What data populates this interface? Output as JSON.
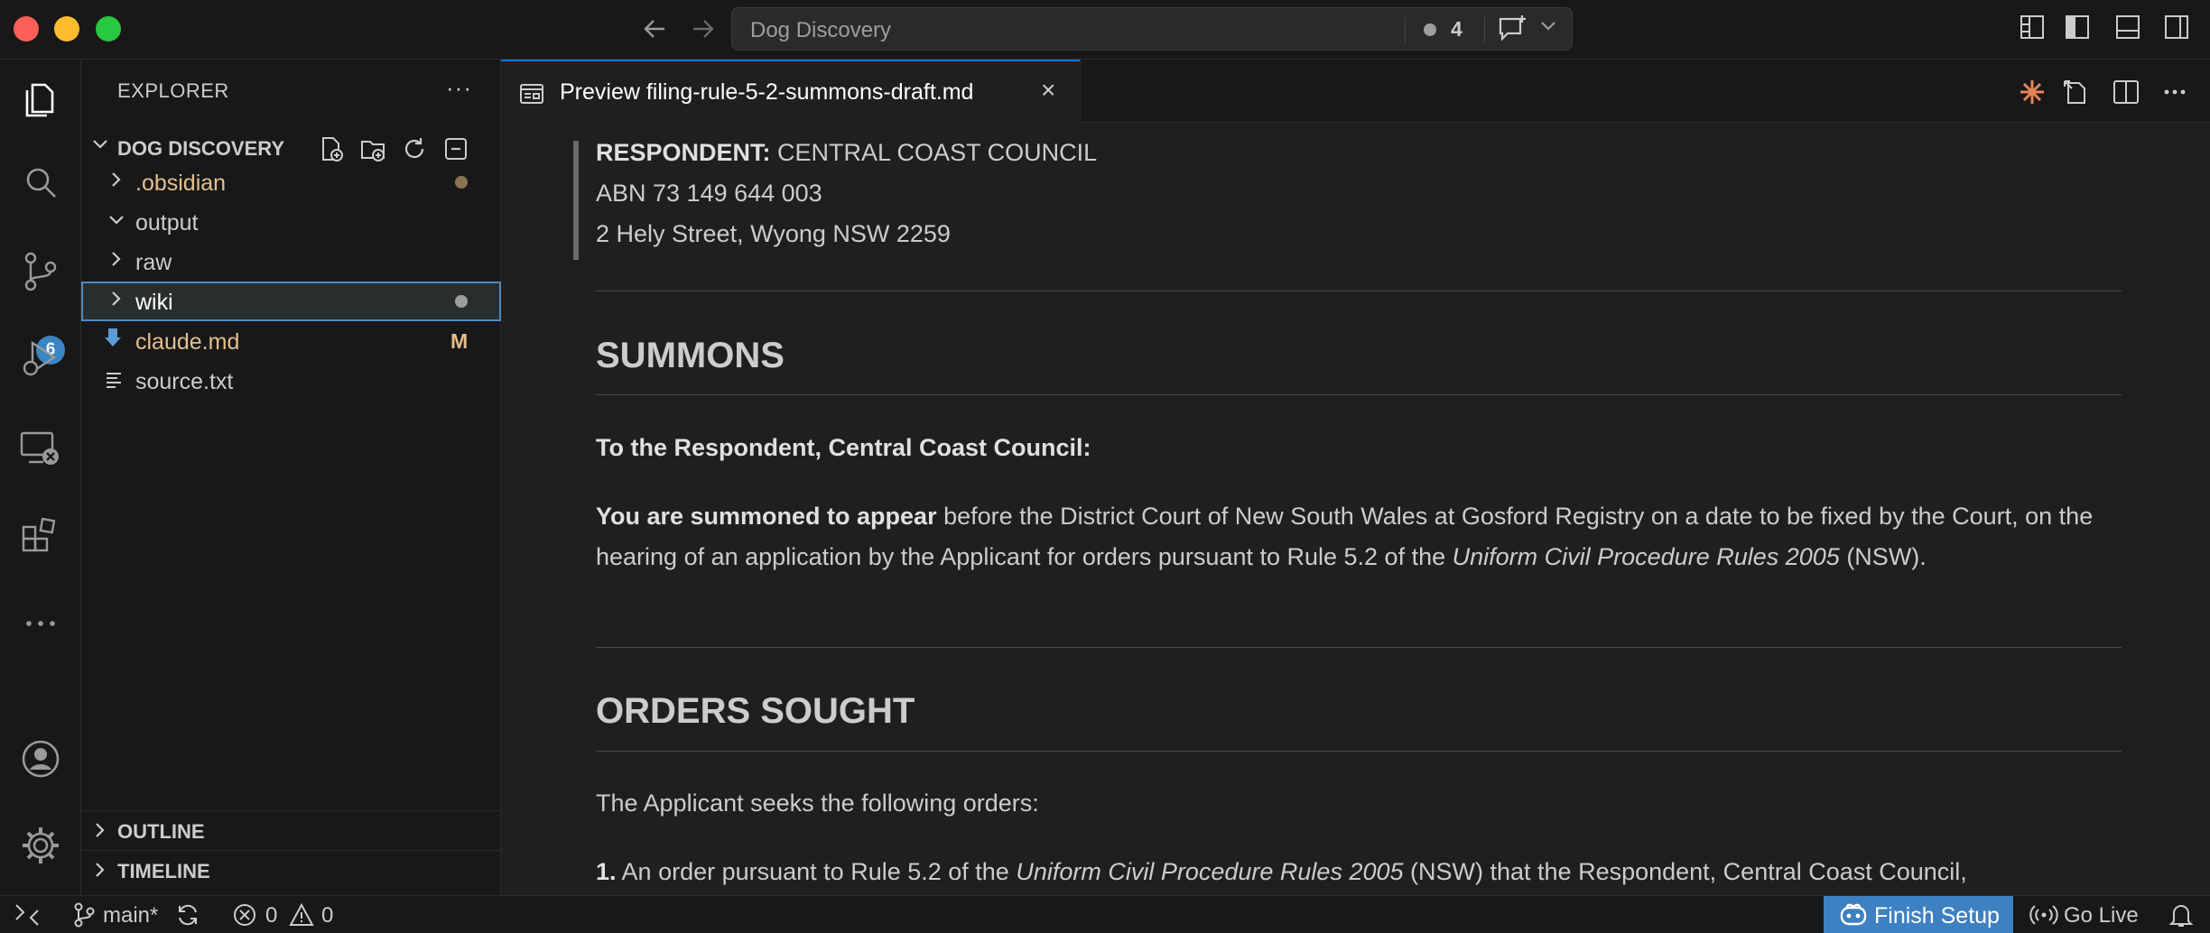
{
  "window": {
    "search_text": "Dog Discovery",
    "problem_count": "4"
  },
  "activity": {
    "scm_badge": "6"
  },
  "sidebar": {
    "title": "EXPLORER",
    "more": "···",
    "folder": "DOG DISCOVERY",
    "items": [
      {
        "name": ".obsidian",
        "color": "#e2c08d"
      },
      {
        "name": "output",
        "color": "#cccccc"
      },
      {
        "name": "raw",
        "color": "#cccccc"
      },
      {
        "name": "wiki",
        "color": "#cccccc"
      },
      {
        "name": "claude.md",
        "color": "#e2c08d",
        "status": "M"
      },
      {
        "name": "source.txt",
        "color": "#cccccc"
      }
    ],
    "outline": "OUTLINE",
    "timeline": "TIMELINE"
  },
  "tab": {
    "label": "Preview filing-rule-5-2-summons-draft.md",
    "close": "×"
  },
  "doc": {
    "respondent_label": "RESPONDENT:",
    "respondent_name": " CENTRAL COAST COUNCIL",
    "abn": "ABN 73 149 644 003",
    "address": "2 Hely Street, Wyong NSW 2259",
    "h_summons": "SUMMONS",
    "to_respondent": "To the Respondent, Central Coast Council:",
    "summoned_bold": "You are summoned to appear",
    "summoned_rest": " before the District Court of New South Wales at Gosford Registry on a date to be fixed by the Court, on the hearing of an application by the Applicant for orders pursuant to Rule 5.2 of the ",
    "rules_italic": "Uniform Civil Procedure Rules 2005",
    "nsw_end": " (NSW).",
    "h_orders": "ORDERS SOUGHT",
    "orders_intro": "The Applicant seeks the following orders:",
    "order1_num": "1.",
    "order1_a": " An order pursuant to Rule 5.2 of the ",
    "order1_italic": "Uniform Civil Procedure Rules 2005",
    "order1_b": " (NSW) that the Respondent, Central Coast Council,"
  },
  "status": {
    "branch": "main*",
    "errors": "0",
    "warnings": "0",
    "finish_setup": "Finish Setup",
    "go_live": "Go Live"
  },
  "colors": {
    "accent": "#0078d4",
    "badge": "#3a85c4",
    "modified": "#e2c08d",
    "finish_bg": "#3e81c2"
  }
}
